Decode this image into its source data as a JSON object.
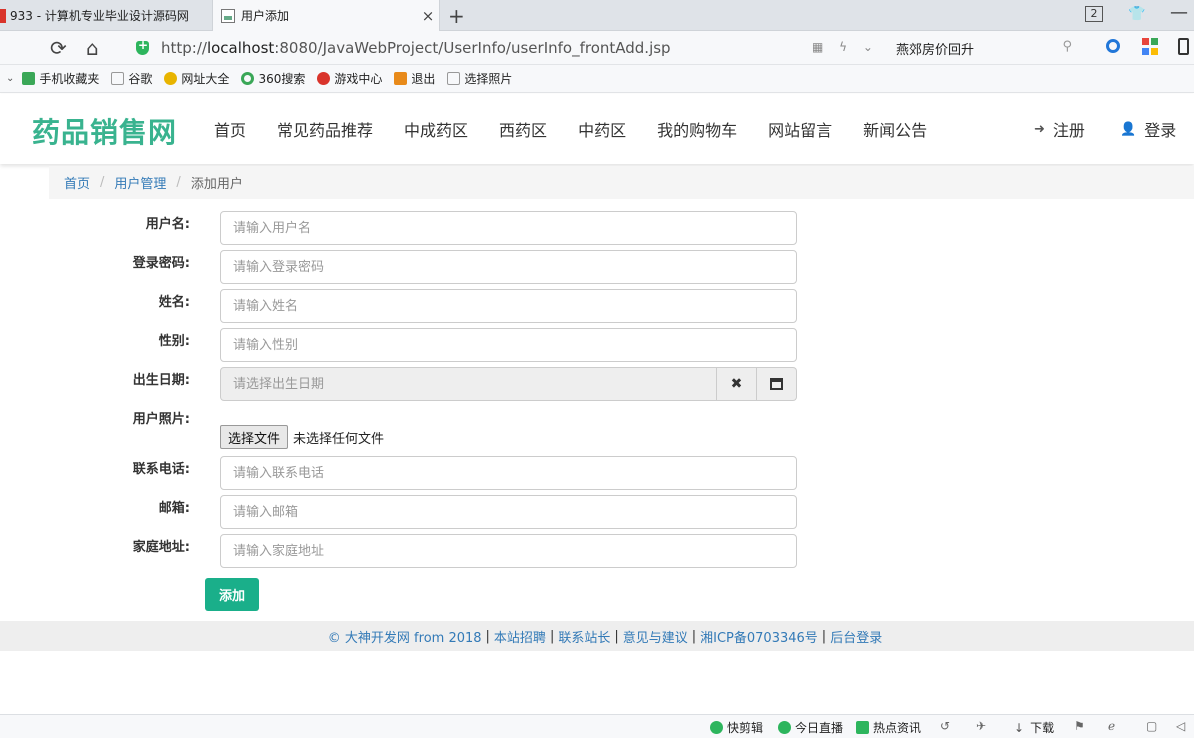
{
  "browser": {
    "tabs": [
      {
        "title": "933 - 计算机专业毕业设计源码网"
      },
      {
        "title": "用户添加",
        "close": "×"
      }
    ],
    "new_tab": "+",
    "tab_count": "2",
    "url_scheme": "http://",
    "url_host": "localhost",
    "url_rest": ":8080/JavaWebProject/UserInfo/userInfo_frontAdd.jsp",
    "search_text": "燕郊房价回升",
    "bookmarks": [
      "手机收藏夹",
      "谷歌",
      "网址大全",
      "360搜索",
      "游戏中心",
      "退出",
      "选择照片"
    ],
    "status_items": [
      "快剪辑",
      "今日直播",
      "热点资讯",
      "下载"
    ]
  },
  "site": {
    "logo": "药品销售网",
    "nav": [
      "首页",
      "常见药品推荐",
      "中成药区",
      "西药区",
      "中药区",
      "我的购物车",
      "网站留言",
      "新闻公告"
    ],
    "register": "注册",
    "login": "登录"
  },
  "breadcrumb": {
    "home": "首页",
    "section": "用户管理",
    "current": "添加用户",
    "sep": "/"
  },
  "form": {
    "username": {
      "label": "用户名:",
      "placeholder": "请输入用户名"
    },
    "password": {
      "label": "登录密码:",
      "placeholder": "请输入登录密码"
    },
    "name": {
      "label": "姓名:",
      "placeholder": "请输入姓名"
    },
    "gender": {
      "label": "性别:",
      "placeholder": "请输入性别"
    },
    "birthday": {
      "label": "出生日期:",
      "placeholder": "请选择出生日期",
      "clear": "✖"
    },
    "photo": {
      "label": "用户照片:",
      "button": "选择文件",
      "status": "未选择任何文件"
    },
    "phone": {
      "label": "联系电话:",
      "placeholder": "请输入联系电话"
    },
    "email": {
      "label": "邮箱:",
      "placeholder": "请输入邮箱"
    },
    "address": {
      "label": "家庭地址:",
      "placeholder": "请输入家庭地址"
    },
    "submit": "添加"
  },
  "footer": {
    "copyright": "© 大神开发网 from 2018",
    "links": [
      "本站招聘",
      "联系站长",
      "意见与建议",
      "湘ICP备0703346号",
      "后台登录"
    ],
    "sep": "|"
  }
}
